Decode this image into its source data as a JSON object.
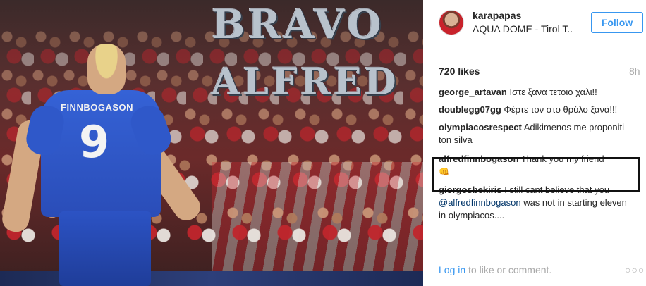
{
  "photo": {
    "headline_line1": "BRAVO",
    "headline_line2": "ALFRED",
    "jersey_name": "FINNBOGASON",
    "jersey_number": "9"
  },
  "post": {
    "username": "karapapas",
    "location": "AQUA DOME - Tirol T..",
    "follow_label": "Follow",
    "likes": "720 likes",
    "time_ago": "8h"
  },
  "comments": [
    {
      "user": "george_artavan",
      "text": "Ιστε ξανα τετοιο χαλι!!"
    },
    {
      "user": "doublegg07gg",
      "text": "Φέρτε τον στο θρύλο ξανά!!!"
    },
    {
      "user": "olympiacosrespect",
      "text": "Adikimenos me proponiti ton silva"
    },
    {
      "user": "alfredfinnbogason",
      "text": "Thank you my friend",
      "emoji": "👊"
    },
    {
      "user": "giorgosbekiris",
      "text_before": "I still cant believe that you",
      "mention": "@alfredfinnbogason",
      "text_after": "was not in starting eleven in olympiacos...."
    }
  ],
  "footer": {
    "login_link": "Log in",
    "login_rest": "to like or comment.",
    "more_glyph": "○○○"
  },
  "colors": {
    "accent": "#3897f0",
    "highlight_box": "#111111",
    "muted": "#a8a8a8"
  },
  "icons": {
    "more": "more-options-icon",
    "avatar": "avatar"
  }
}
